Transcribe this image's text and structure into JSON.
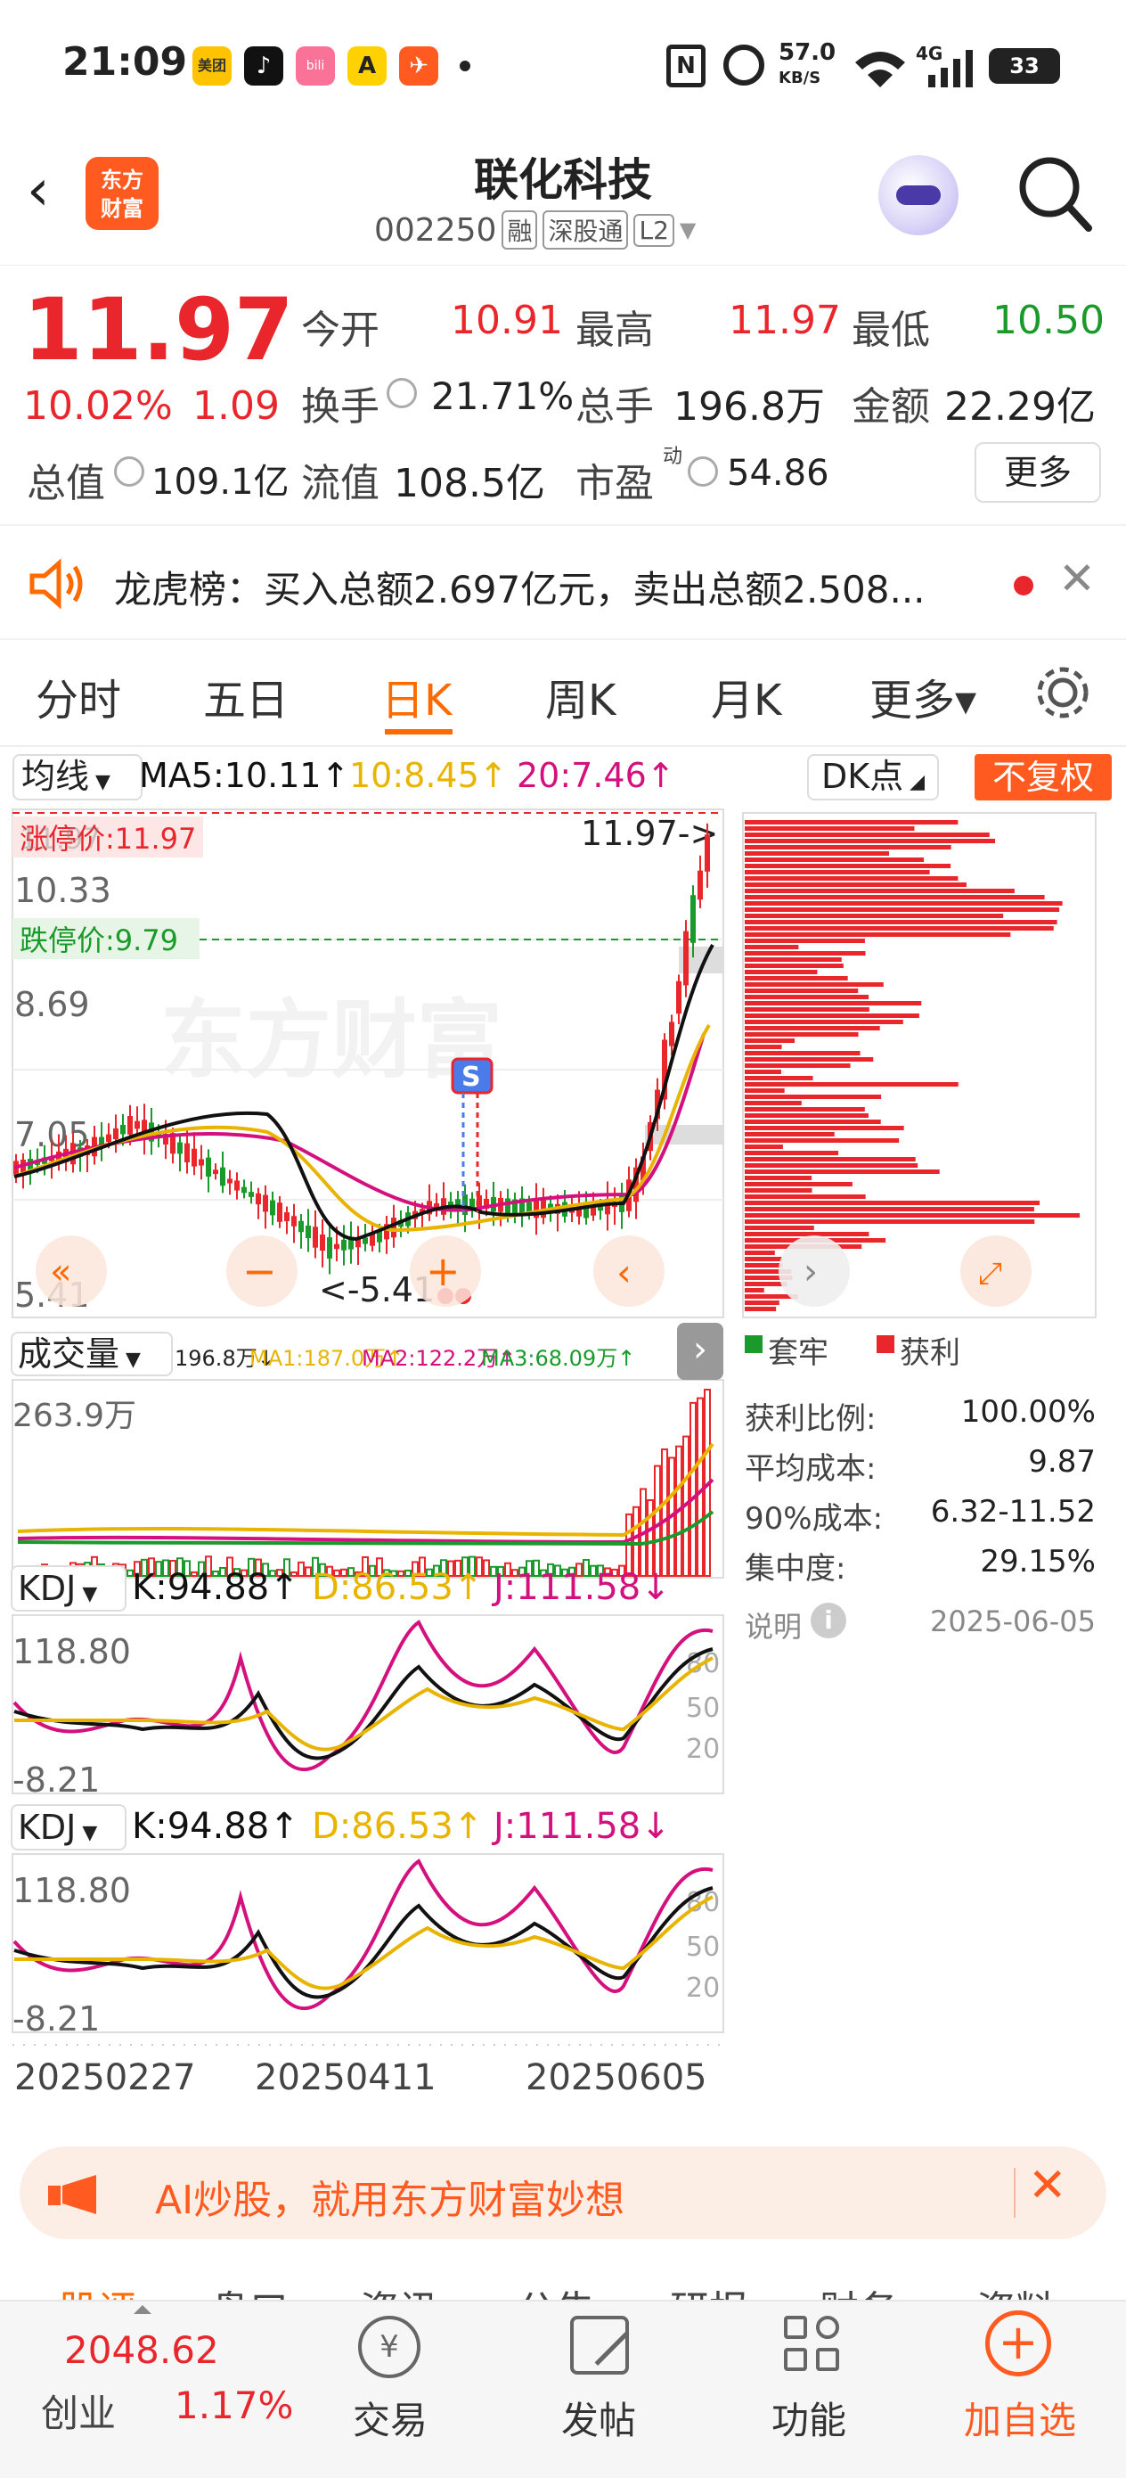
{
  "status": {
    "time": "21:09",
    "speed_top": "57.0",
    "speed_bottom": "KB/S",
    "net": "4G",
    "battery": "33",
    "app_icons": [
      {
        "label": "美团",
        "color": "#ffc300"
      },
      {
        "label": "♪",
        "color": "#111111"
      },
      {
        "label": "bili",
        "color": "#fb7299"
      },
      {
        "label": "A",
        "color": "#ffd100"
      },
      {
        "label": "✈",
        "color": "#ff5a1f"
      }
    ]
  },
  "header": {
    "title": "联化科技",
    "code": "002250",
    "tag1": "融",
    "tag2": "深股通",
    "tag3": "L2",
    "logo_line1": "东方",
    "logo_line2": "财富"
  },
  "quote": {
    "price": "11.97",
    "pct": "10.02%",
    "chg": "1.09",
    "open_label": "今开",
    "open": "10.91",
    "high_label": "最高",
    "high": "11.97",
    "low_label": "最低",
    "low": "10.50",
    "turnover_label": "换手",
    "turnover": "21.71%",
    "vol_label": "总手",
    "vol": "196.8万",
    "amt_label": "金额",
    "amt": "22.29亿",
    "mcap_label": "总值",
    "mcap": "109.1亿",
    "float_label": "流值",
    "float": "108.5亿",
    "pe_label": "市盈",
    "pe_sup": "动",
    "pe": "54.86",
    "more": "更多"
  },
  "notice": {
    "text": "龙虎榜：买入总额2.697亿元，卖出总额2.508..."
  },
  "tabs": [
    "分时",
    "五日",
    "日K",
    "周K",
    "月K",
    "更多▾"
  ],
  "active_tab": "日K",
  "ma": {
    "select": "均线",
    "ma5": "MA5:10.11↑",
    "ma10": "10:8.45↑",
    "ma20": "20:7.46↑",
    "dk": "DK点",
    "fq": "不复权"
  },
  "kline": {
    "limit_up": "涨停价:11.97",
    "limit_down": "跌停价:9.79",
    "y_high": "11.97",
    "y1": "10.33",
    "y2": "8.69",
    "y3": "7.05",
    "y_low": "5.41",
    "high_mark": "11.97->",
    "low_mark": "<-5.41",
    "s_marker": "S",
    "watermark": "东方财富"
  },
  "volume": {
    "select": "成交量",
    "v": "196.8万↓",
    "ma1": "MA1:187.0万↑",
    "ma2": "MA2:122.2万↑",
    "ma3": "MA3:68.09万↑",
    "ymax": "263.9万"
  },
  "kdj1": {
    "select": "KDJ",
    "k": "K:94.88↑",
    "d": "D:86.53↑",
    "j": "J:111.58↓",
    "ymax": "118.80",
    "ymin": "-8.21",
    "lv80": "80",
    "lv50": "50",
    "lv20": "20"
  },
  "kdj2": {
    "select": "KDJ",
    "k": "K:94.88↑",
    "d": "D:86.53↑",
    "j": "J:111.58↓",
    "ymax": "118.80",
    "ymin": "-8.21",
    "lv80": "80",
    "lv50": "50",
    "lv20": "20"
  },
  "dates": [
    "20250227",
    "20250411",
    "20250605"
  ],
  "chips": {
    "legend1": "套牢",
    "legend2": "获利",
    "rows": [
      {
        "label": "获利比例:",
        "value": "100.00%"
      },
      {
        "label": "平均成本:",
        "value": "9.87"
      },
      {
        "label": "90%成本:",
        "value": "6.32-11.52"
      },
      {
        "label": "集中度:",
        "value": "29.15%"
      }
    ],
    "explain": "说明",
    "date": "2025-06-05"
  },
  "ai_banner": {
    "text": "AI炒股，就用东方财富妙想"
  },
  "hidden_tabs": [
    "股评",
    "盘口",
    "资讯",
    "公告",
    "研报",
    "财务",
    "资料"
  ],
  "bottom": {
    "index_value": "2048.62",
    "index_name": "创业",
    "index_pct": "1.17%",
    "trade": "交易",
    "post": "发帖",
    "func": "功能",
    "add": "加自选"
  },
  "colors": {
    "up": "#e8262c",
    "down": "#1a9a2a",
    "ma5": "#111111",
    "ma10": "#e8b400",
    "ma20": "#d4107e",
    "accent": "#ff6a00"
  }
}
